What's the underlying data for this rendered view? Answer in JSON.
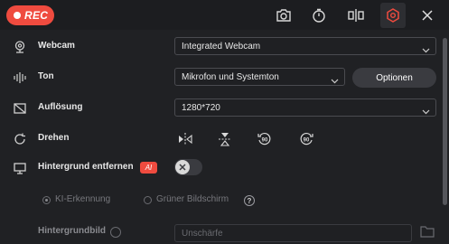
{
  "header": {
    "rec_label": "REC",
    "icons": [
      "camera-icon",
      "timer-icon",
      "split-icon",
      "settings-hex-icon",
      "close-icon"
    ]
  },
  "webcam": {
    "label": "Webcam",
    "value": "Integrated Webcam"
  },
  "sound": {
    "label": "Ton",
    "value": "Mikrofon und Systemton",
    "options_button": "Optionen"
  },
  "resolution": {
    "label": "Auflösung",
    "value": "1280*720"
  },
  "rotate": {
    "label": "Drehen",
    "actions": [
      "flip-horizontal-icon",
      "flip-vertical-icon",
      "rotate-left-90-icon",
      "rotate-right-90-icon"
    ],
    "rotate_left_text": "90",
    "rotate_right_text": "90"
  },
  "background": {
    "label": "Hintergrund entfernen",
    "ai_badge": "AI",
    "toggle_on": false,
    "mode_ai": "KI-Erkennung",
    "mode_green": "Grüner Bildschirm",
    "help": "?"
  },
  "background_image": {
    "label": "Hintergrundbild",
    "placeholder": "Unschärfe"
  },
  "colors": {
    "accent": "#ef4b3f",
    "bg": "#202124",
    "topbar": "#1c1d20"
  }
}
